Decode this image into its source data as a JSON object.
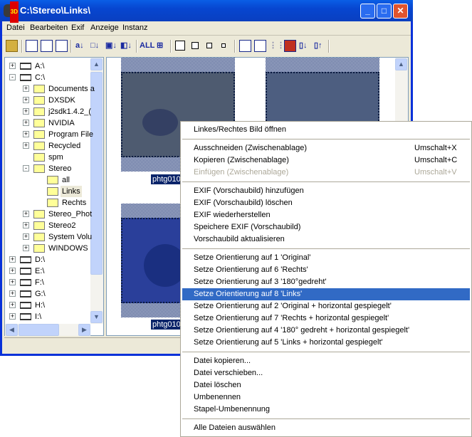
{
  "window": {
    "title": "C:\\Stereo\\Links\\",
    "buttons": {
      "minimize": "_",
      "maximize": "□",
      "close": "✕"
    }
  },
  "menubar": [
    "Datei",
    "Bearbeiten",
    "Exif",
    "Anzeige",
    "Instanz"
  ],
  "toolbar": {
    "all_label": "ALL"
  },
  "tree": [
    {
      "label": "A:\\",
      "level": 0,
      "type": "floppy",
      "expander": "+"
    },
    {
      "label": "C:\\",
      "level": 0,
      "type": "drive",
      "expander": "-"
    },
    {
      "label": "Documents a",
      "level": 1,
      "type": "folder",
      "expander": "+"
    },
    {
      "label": "DXSDK",
      "level": 1,
      "type": "folder",
      "expander": "+"
    },
    {
      "label": "j2sdk1.4.2_(",
      "level": 1,
      "type": "folder",
      "expander": "+"
    },
    {
      "label": "NVIDIA",
      "level": 1,
      "type": "folder",
      "expander": "+"
    },
    {
      "label": "Program File",
      "level": 1,
      "type": "folder",
      "expander": "+"
    },
    {
      "label": "Recycled",
      "level": 1,
      "type": "folder",
      "expander": "+"
    },
    {
      "label": "spm",
      "level": 1,
      "type": "folder",
      "expander": ""
    },
    {
      "label": "Stereo",
      "level": 1,
      "type": "folder",
      "expander": "-"
    },
    {
      "label": "all",
      "level": 2,
      "type": "folder",
      "expander": ""
    },
    {
      "label": "Links",
      "level": 2,
      "type": "folder-open",
      "expander": "",
      "selected": true
    },
    {
      "label": "Rechts",
      "level": 2,
      "type": "folder",
      "expander": ""
    },
    {
      "label": "Stereo_Phot",
      "level": 1,
      "type": "folder",
      "expander": "+"
    },
    {
      "label": "Stereo2",
      "level": 1,
      "type": "folder",
      "expander": "+"
    },
    {
      "label": "System Volu",
      "level": 1,
      "type": "folder",
      "expander": "+"
    },
    {
      "label": "WINDOWS",
      "level": 1,
      "type": "folder",
      "expander": "+"
    },
    {
      "label": "D:\\",
      "level": 0,
      "type": "drive",
      "expander": "+"
    },
    {
      "label": "E:\\",
      "level": 0,
      "type": "drive",
      "expander": "+"
    },
    {
      "label": "F:\\",
      "level": 0,
      "type": "drive",
      "expander": "+"
    },
    {
      "label": "G:\\",
      "level": 0,
      "type": "drive",
      "expander": "+"
    },
    {
      "label": "H:\\",
      "level": 0,
      "type": "drive",
      "expander": "+"
    },
    {
      "label": "I:\\",
      "level": 0,
      "type": "network-drive",
      "expander": "+"
    }
  ],
  "thumbnails": [
    {
      "label": "phtg010"
    },
    {
      "label": ""
    },
    {
      "label": "phtg010"
    },
    {
      "label": ""
    }
  ],
  "context_menu": [
    {
      "label": "Linkes/Rechtes Bild öffnen"
    },
    {
      "sep": true
    },
    {
      "label": "Ausschneiden (Zwischenablage)",
      "shortcut": "Umschalt+X"
    },
    {
      "label": "Kopieren (Zwischenablage)",
      "shortcut": "Umschalt+C"
    },
    {
      "label": "Einfügen (Zwischenablage)",
      "shortcut": "Umschalt+V",
      "disabled": true
    },
    {
      "sep": true
    },
    {
      "label": "EXIF (Vorschaubild) hinzufügen"
    },
    {
      "label": "EXIF (Vorschaubild) löschen"
    },
    {
      "label": "EXIF wiederherstellen"
    },
    {
      "label": "Speichere EXIF (Vorschaubild)"
    },
    {
      "label": "Vorschaubild aktualisieren"
    },
    {
      "sep": true
    },
    {
      "label": "Setze Orientierung auf 1 'Original'"
    },
    {
      "label": "Setze Orientierung auf 6 'Rechts'"
    },
    {
      "label": "Setze Orientierung auf 3 '180°gedreht'"
    },
    {
      "label": "Setze Orientierung auf 8 'Links'",
      "highlighted": true
    },
    {
      "label": "Setze Orientierung auf 2 'Original + horizontal gespiegelt'"
    },
    {
      "label": "Setze Orientierung auf 7 'Rechts + horizontal gespiegelt'"
    },
    {
      "label": "Setze Orientierung auf 4 '180° gedreht + horizontal gespiegelt'"
    },
    {
      "label": "Setze Orientierung auf 5 'Links + horizontal gespiegelt'"
    },
    {
      "sep": true
    },
    {
      "label": "Datei kopieren..."
    },
    {
      "label": "Datei verschieben..."
    },
    {
      "label": "Datei löschen"
    },
    {
      "label": "Umbenennen"
    },
    {
      "label": "Stapel-Umbenennung"
    },
    {
      "sep": true
    },
    {
      "label": "Alle Dateien auswählen"
    }
  ],
  "colors": {
    "titlebar": "#0a5ee6",
    "highlight": "#316ac5",
    "selection": "#0a246a"
  }
}
